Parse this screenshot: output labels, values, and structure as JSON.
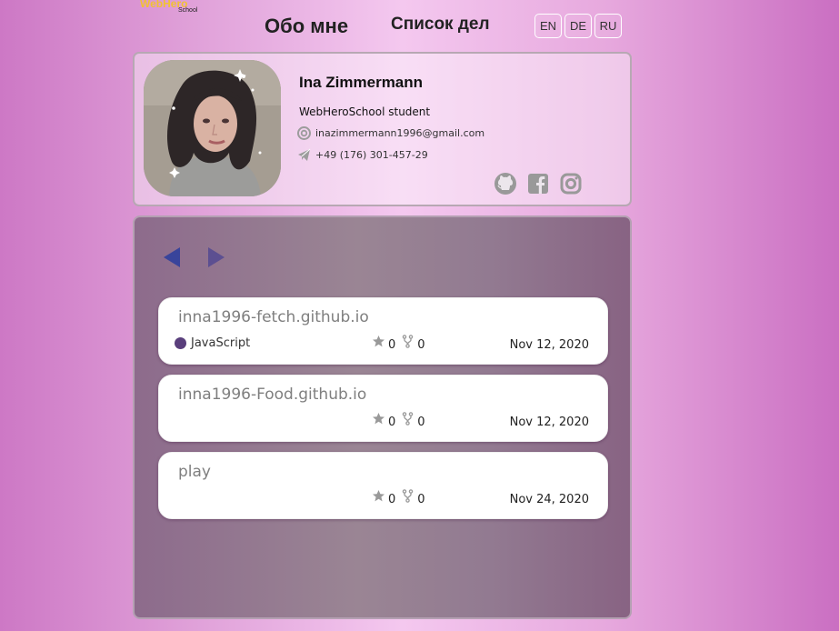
{
  "logo": {
    "main": "WebHero",
    "sub": "School"
  },
  "nav": {
    "about": "Обо мне",
    "todo": "Список дел"
  },
  "languages": [
    "EN",
    "DE",
    "RU"
  ],
  "profile": {
    "name": "Ina Zimmermann",
    "role": "WebHeroSchool student",
    "email": "inazimmermann1996@gmail.com",
    "phone": "+49 (176) 301-457-29",
    "social": [
      "github-icon",
      "facebook-icon",
      "instagram-icon"
    ]
  },
  "repos": [
    {
      "name": "inna1996-fetch.github.io",
      "language": "JavaScript",
      "stars": "0",
      "forks": "0",
      "date": "Nov 12, 2020"
    },
    {
      "name": "inna1996-Food.github.io",
      "language": "",
      "stars": "0",
      "forks": "0",
      "date": "Nov 12, 2020"
    },
    {
      "name": "play",
      "language": "",
      "stars": "0",
      "forks": "0",
      "date": "Nov 24, 2020"
    }
  ],
  "colors": {
    "logo": "#f1c232",
    "panel": "#9a8594",
    "accent_arrow": "#39449b",
    "language_dot": "#5a3f7c",
    "icon_gray": "#999999"
  }
}
